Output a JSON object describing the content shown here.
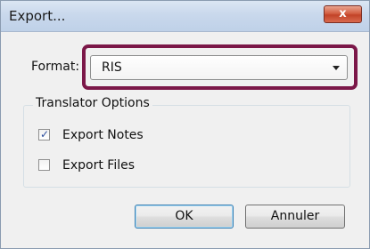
{
  "window": {
    "title": "Export...",
    "close_symbol": "x"
  },
  "format": {
    "label": "Format:",
    "selected": "RIS"
  },
  "translator_options": {
    "legend": "Translator Options",
    "export_notes": {
      "label": "Export Notes",
      "checked": true
    },
    "export_files": {
      "label": "Export Files",
      "checked": false
    }
  },
  "buttons": {
    "ok": "OK",
    "cancel": "Annuler"
  },
  "colors": {
    "highlight": "#7b1748",
    "close_button": "#c24328"
  }
}
